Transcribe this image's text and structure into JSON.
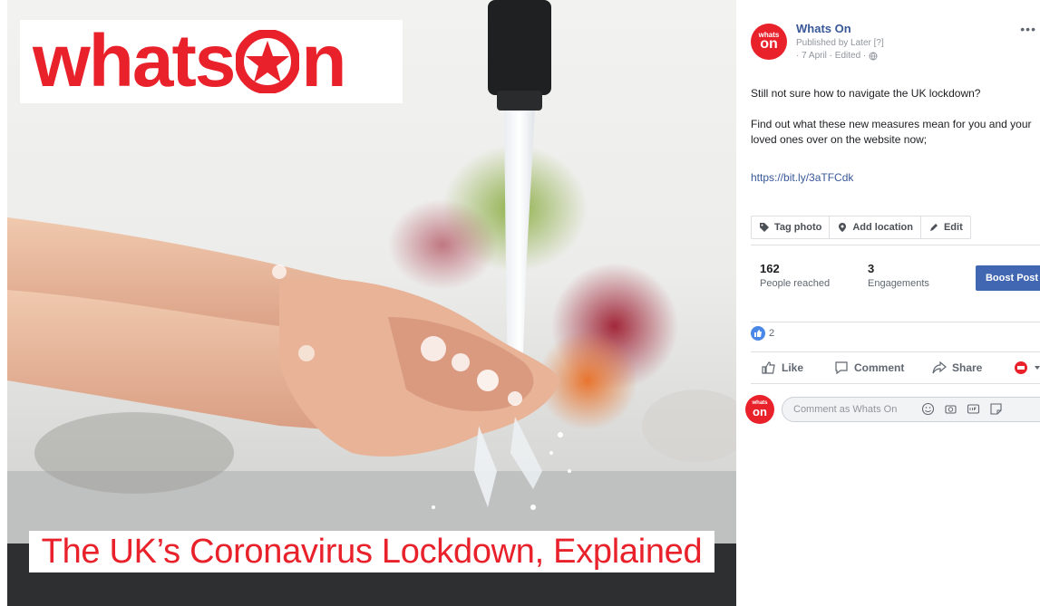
{
  "photo": {
    "logo": {
      "word_left": "whats",
      "word_right": "n"
    },
    "caption": "The UK’s Coronavirus Lockdown, Explained"
  },
  "post": {
    "avatar": {
      "line1": "whats",
      "line2": "on"
    },
    "page_name": "Whats On",
    "published_by": "Published by Later [?]",
    "date": "· 7 April · Edited ·",
    "more_label": "•••",
    "text_line1": "Still not sure how to navigate the UK lockdown?",
    "text_line2": "Find out what these new measures mean for you and your loved ones over on the website now;",
    "link": "https://bit.ly/3aTFCdk",
    "photo_actions": {
      "tag": "Tag photo",
      "location": "Add location",
      "edit": "Edit"
    },
    "stats": {
      "reached_count": "162",
      "reached_label": "People reached",
      "engagements_count": "3",
      "engagements_label": "Engagements",
      "boost_label": "Boost Post"
    },
    "reaction_count": "2",
    "buttons": {
      "like": "Like",
      "comment": "Comment",
      "share": "Share"
    },
    "comment_placeholder": "Comment as Whats On"
  },
  "colors": {
    "brand_red": "#e8212b",
    "fb_blue": "#4267b2",
    "link_blue": "#385898"
  }
}
